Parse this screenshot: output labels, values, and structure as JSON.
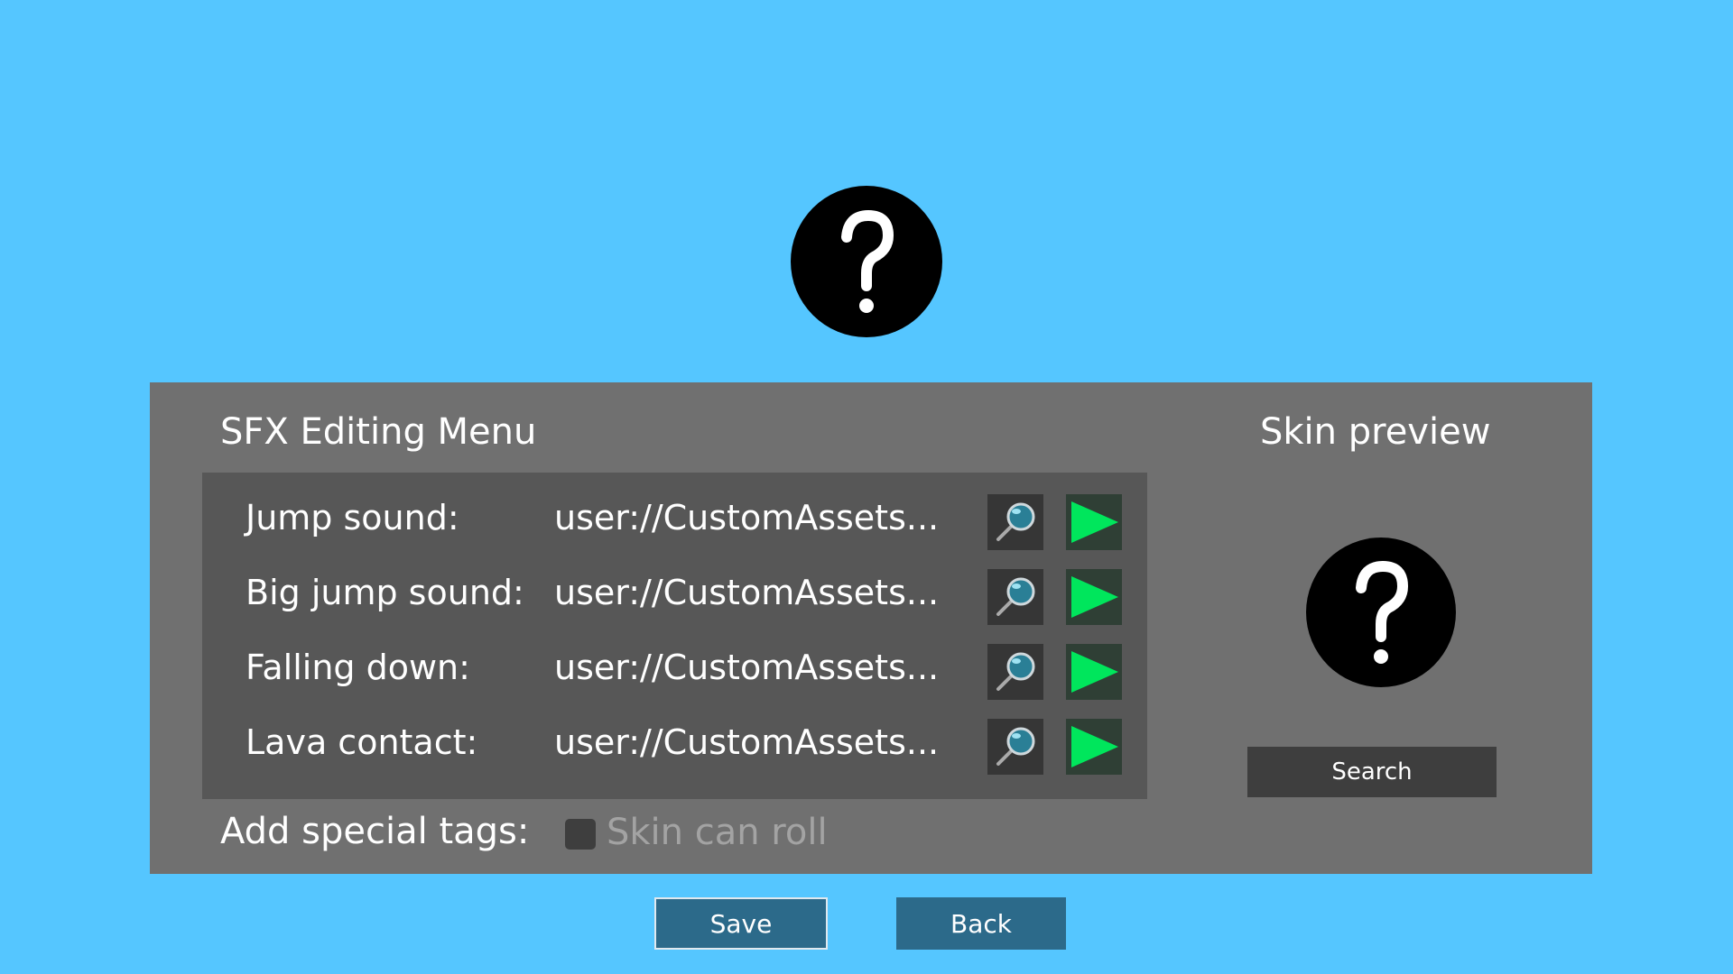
{
  "avatar": {
    "icon": "question-mark-icon",
    "glyph": "?"
  },
  "panel": {
    "title": "SFX Editing Menu",
    "rows": [
      {
        "label": "Jump sound:",
        "path": "user://CustomAssets...",
        "search_icon": "magnifier-icon",
        "play_icon": "play-icon"
      },
      {
        "label": "Big jump sound:",
        "path": "user://CustomAssets...",
        "search_icon": "magnifier-icon",
        "play_icon": "play-icon"
      },
      {
        "label": "Falling down:",
        "path": "user://CustomAssets...",
        "search_icon": "magnifier-icon",
        "play_icon": "play-icon"
      },
      {
        "label": "Lava contact:",
        "path": "user://CustomAssets...",
        "search_icon": "magnifier-icon",
        "play_icon": "play-icon"
      }
    ],
    "tags": {
      "label": "Add special tags:",
      "checkbox_label": "Skin can roll",
      "checked": false
    }
  },
  "preview": {
    "title": "Skin preview",
    "avatar_glyph": "?",
    "search_label": "Search"
  },
  "footer": {
    "save_label": "Save",
    "back_label": "Back"
  },
  "colors": {
    "background": "#55c6ff",
    "panel": "#707070",
    "rows_box": "#575757",
    "play_green": "#00e65c",
    "button_blue": "#2c6a8a"
  }
}
